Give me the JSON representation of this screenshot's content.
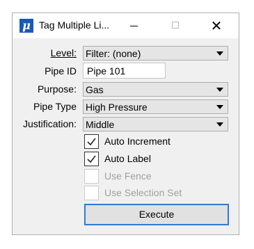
{
  "window": {
    "title": "Tag Multiple Li...",
    "icon_glyph": "μ",
    "close_glyph": "✕"
  },
  "form": {
    "level": {
      "label": "Level:",
      "value": "Filter: (none)"
    },
    "pipe_id": {
      "label": "Pipe ID",
      "value": "Pipe 101"
    },
    "purpose": {
      "label": "Purpose:",
      "value": "Gas"
    },
    "pipe_type": {
      "label": "Pipe Type",
      "value": "High Pressure"
    },
    "justification": {
      "label": "Justification:",
      "value": "Middle"
    }
  },
  "options": [
    {
      "label": "Auto Increment",
      "checked": true,
      "enabled": true
    },
    {
      "label": "Auto Label",
      "checked": true,
      "enabled": true
    },
    {
      "label": "Use Fence",
      "checked": false,
      "enabled": false
    },
    {
      "label": "Use Selection Set",
      "checked": false,
      "enabled": false
    }
  ],
  "execute_label": "Execute"
}
